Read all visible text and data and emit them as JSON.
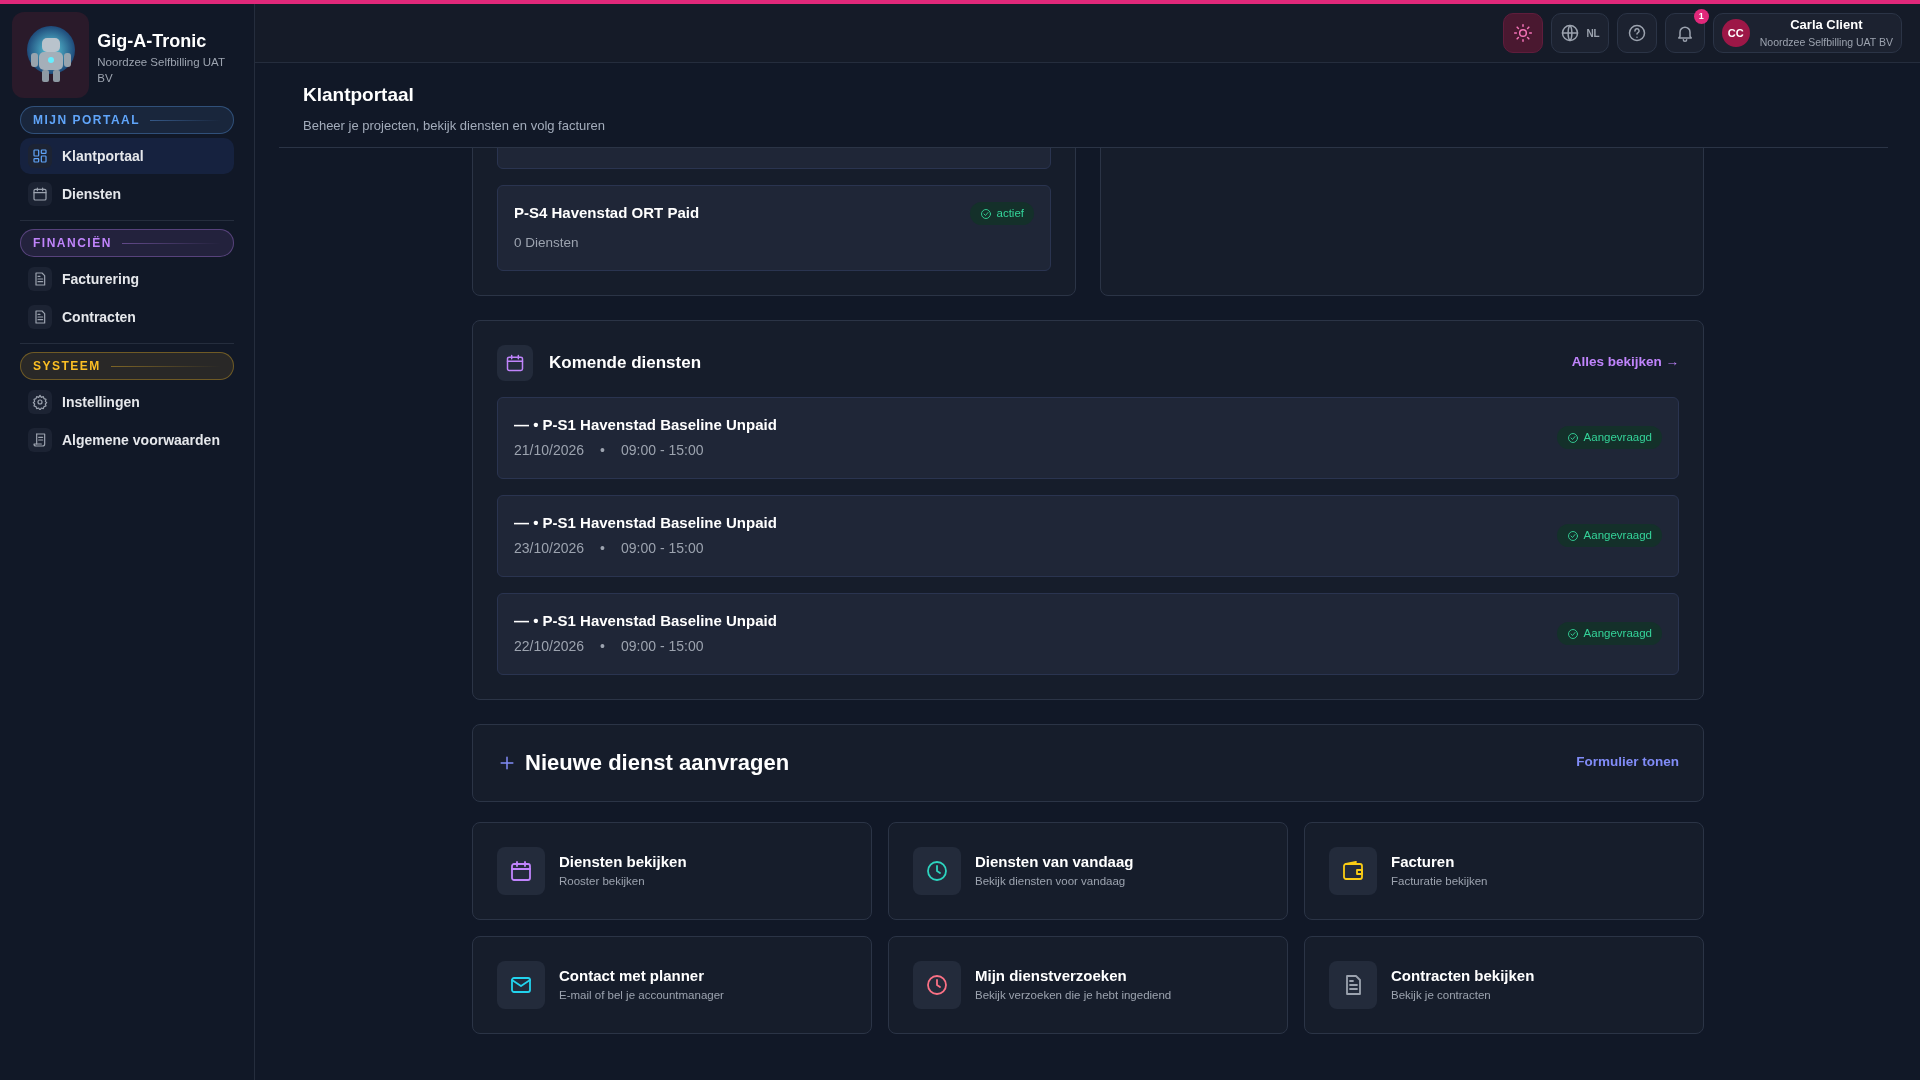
{
  "brand": {
    "name": "Gig-A-Tronic",
    "company": "Noordzee Selfbilling UAT BV"
  },
  "sidebar": {
    "sections": [
      {
        "label": "MIJN PORTAAL",
        "color": "#60a5fa",
        "items": [
          {
            "label": "Klantportaal",
            "kind": "grid",
            "selected": true
          },
          {
            "label": "Diensten",
            "kind": "calendar",
            "selected": false
          }
        ]
      },
      {
        "label": "FINANCIËN",
        "color": "#c084fc",
        "items": [
          {
            "label": "Facturering",
            "kind": "document",
            "selected": false
          },
          {
            "label": "Contracten",
            "kind": "document",
            "selected": false
          }
        ]
      },
      {
        "label": "SYSTEEM",
        "color": "#fbbf24",
        "items": [
          {
            "label": "Instellingen",
            "kind": "gear",
            "selected": false
          },
          {
            "label": "Algemene voorwaarden",
            "kind": "scroll",
            "selected": false
          }
        ]
      }
    ]
  },
  "topbar": {
    "language": "NL",
    "notification_count": "1",
    "user": {
      "initials": "CC",
      "name": "Carla Client",
      "company": "Noordzee Selfbilling UAT BV"
    }
  },
  "page": {
    "title": "Klantportaal",
    "subtitle": "Beheer je projecten, bekijk diensten en volg facturen"
  },
  "projects": [
    {
      "name": "P-S4 Havenstad ORT Paid",
      "status": "actief",
      "count": "0 Diensten"
    }
  ],
  "upcoming": {
    "title": "Komende diensten",
    "link": "Alles bekijken →",
    "items": [
      {
        "title": "— • P-S1 Havenstad Baseline Unpaid",
        "date": "21/10/2026",
        "separator": "•",
        "time": "09:00 - 15:00",
        "status": "Aangevraagd"
      },
      {
        "title": "— • P-S1 Havenstad Baseline Unpaid",
        "date": "23/10/2026",
        "separator": "•",
        "time": "09:00 - 15:00",
        "status": "Aangevraagd"
      },
      {
        "title": "— • P-S1 Havenstad Baseline Unpaid",
        "date": "22/10/2026",
        "separator": "•",
        "time": "09:00 - 15:00",
        "status": "Aangevraagd"
      }
    ]
  },
  "request": {
    "title": "Nieuwe dienst aanvragen",
    "link": "Formulier tonen"
  },
  "tiles": [
    {
      "title": "Diensten bekijken",
      "subtitle": "Rooster bekijken",
      "kind": "calendar",
      "color": "#c084fc"
    },
    {
      "title": "Diensten van vandaag",
      "subtitle": "Bekijk diensten voor vandaag",
      "kind": "clock",
      "color": "#2dd4bf"
    },
    {
      "title": "Facturen",
      "subtitle": "Facturatie bekijken",
      "kind": "wallet",
      "color": "#facc15"
    },
    {
      "title": "Contact met planner",
      "subtitle": "E-mail of bel je accountmanager",
      "kind": "mail",
      "color": "#22d3ee"
    },
    {
      "title": "Mijn dienstverzoeken",
      "subtitle": "Bekijk verzoeken die je hebt ingediend",
      "kind": "clock",
      "color": "#fb7185"
    },
    {
      "title": "Contracten bekijken",
      "subtitle": "Bekijk je contracten",
      "kind": "document",
      "color": "#9ca3af"
    }
  ]
}
